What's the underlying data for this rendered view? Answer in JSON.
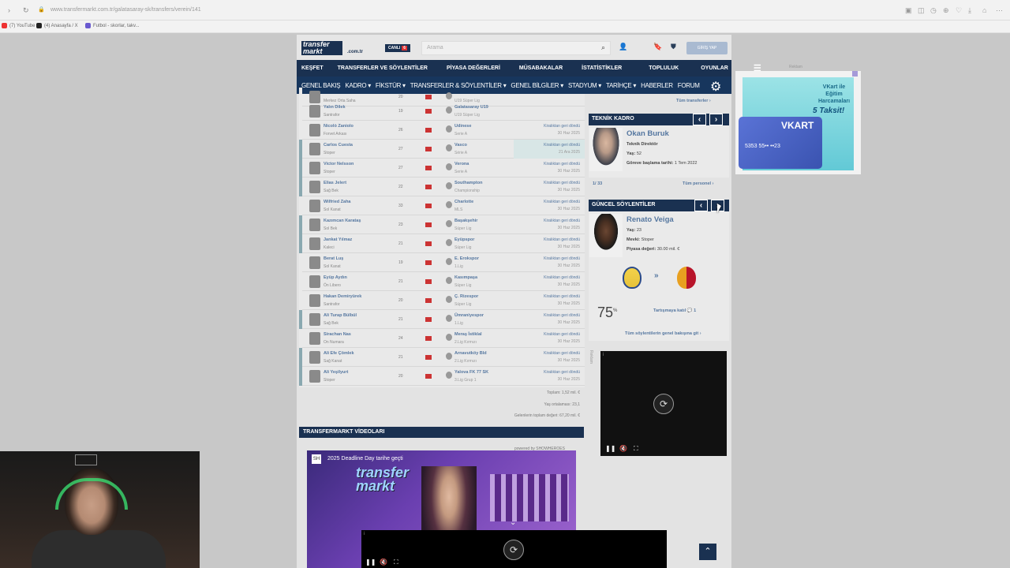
{
  "browser": {
    "url": "www.transfermarkt.com.tr/galatasaray-sk/transfers/verein/141",
    "bookmarks": [
      "(7) YouTube",
      "(4) Anasayfa / X",
      "Futbol - skorlar, takv..."
    ]
  },
  "header": {
    "logo_line1": "transfer",
    "logo_line2": "markt",
    "domain": ".com.tr",
    "live_label": "CANLI",
    "live_count": "6",
    "search_placeholder": "Arama",
    "login_label": "GİRİŞ YAP"
  },
  "main_nav": [
    "KEŞFET",
    "TRANSFERLER VE SÖYLENTİLER",
    "PİYASA DEĞERLERİ",
    "MÜSABAKALAR",
    "İSTATİSTİKLER",
    "TOPLULUK",
    "OYUNLAR"
  ],
  "sub_nav": [
    "GENEL BAKIŞ",
    "KADRO ▾",
    "FİKSTÜR ▾",
    "TRANSFERLER & SÖYLENTİLER ▾",
    "GENEL BİLGİLER ▾",
    "STADYUM ▾",
    "TARİHÇE ▾",
    "HABERLER",
    "FORUM"
  ],
  "table_rows": [
    {
      "name": "",
      "position": "Merkez Orta Saha",
      "age": "20",
      "club": "",
      "league": "U19 Süper Lig",
      "status": "",
      "date": "",
      "bar": "#e9e9e9"
    },
    {
      "name": "Yalın Dilek",
      "position": "Santrafor",
      "age": "19",
      "club": "Galatasaray U19",
      "league": "U19 Süper Lig",
      "status": "",
      "date": "",
      "bar": "#e9e9e9"
    },
    {
      "name": "Nicolò Zaniolo",
      "position": "Forvet Arkası",
      "age": "26",
      "club": "Udinese",
      "league": "Serie A",
      "status": "Kiralıktan geri döndü",
      "date": "30 Haz 2025",
      "bar": "#e9e9e9"
    },
    {
      "name": "Carlos Cuesta",
      "position": "Stoper",
      "age": "27",
      "club": "Vasco",
      "league": "Série A",
      "status": "Kiralıktan geri döndü",
      "date": "21 Ara 2025",
      "bar": "#8aa8b0"
    },
    {
      "name": "Victor Nelsson",
      "position": "Stoper",
      "age": "27",
      "club": "Verona",
      "league": "Serie A",
      "status": "Kiralıktan geri döndü",
      "date": "30 Haz 2025",
      "bar": "#8aa8b0"
    },
    {
      "name": "Elias Jelert",
      "position": "Sağ Bek",
      "age": "22",
      "club": "Southampton",
      "league": "Championship",
      "status": "Kiralıktan geri döndü",
      "date": "30 Haz 2025",
      "bar": "#8aa8b0"
    },
    {
      "name": "Wilfried Zaha",
      "position": "Sol Kanat",
      "age": "33",
      "club": "Charlotte",
      "league": "MLS",
      "status": "Kiralıktan geri döndü",
      "date": "30 Haz 2025",
      "bar": "#e9e9e9"
    },
    {
      "name": "Kazımcan Karataş",
      "position": "Sol Bek",
      "age": "23",
      "club": "Başakşehir",
      "league": "Süper Lig",
      "status": "Kiralıktan geri döndü",
      "date": "30 Haz 2025",
      "bar": "#8aa8b0"
    },
    {
      "name": "Jankat Yılmaz",
      "position": "Kaleci",
      "age": "21",
      "club": "Eyüpspor",
      "league": "Süper Lig",
      "status": "Kiralıktan geri döndü",
      "date": "30 Haz 2025",
      "bar": "#8aa8b0"
    },
    {
      "name": "Berat Luş",
      "position": "Sol Kanat",
      "age": "19",
      "club": "E. Erokspor",
      "league": "1.Lig",
      "status": "Kiralıktan geri döndü",
      "date": "30 Haz 2025",
      "bar": "#e9e9e9"
    },
    {
      "name": "Eyüp Aydın",
      "position": "Ön Libero",
      "age": "21",
      "club": "Kasımpaşa",
      "league": "Süper Lig",
      "status": "Kiralıktan geri döndü",
      "date": "30 Haz 2025",
      "bar": "#e9e9e9"
    },
    {
      "name": "Hakan Demiryürek",
      "position": "Santrafor",
      "age": "20",
      "club": "Ç. Rizespor",
      "league": "Süper Lig",
      "status": "Kiralıktan geri döndü",
      "date": "30 Haz 2025",
      "bar": "#e9e9e9"
    },
    {
      "name": "Ali Turap Bülbül",
      "position": "Sağ Bek",
      "age": "21",
      "club": "Ümraniyespor",
      "league": "1.Lig",
      "status": "Kiralıktan geri döndü",
      "date": "30 Haz 2025",
      "bar": "#8aa8b0"
    },
    {
      "name": "Sirachan Nas",
      "position": "On Numara",
      "age": "24",
      "club": "Meraş İstiklal",
      "league": "2.Lig Kırmızı",
      "status": "Kiralıktan geri döndü",
      "date": "30 Haz 2025",
      "bar": "#e9e9e9"
    },
    {
      "name": "Ali Efe Çömlek",
      "position": "Sağ Kanat",
      "age": "21",
      "club": "Arnavutköy Bld",
      "league": "2.Lig Kırmızı",
      "status": "Kiralıktan geri döndü",
      "date": "30 Haz 2025",
      "bar": "#8aa8b0"
    },
    {
      "name": "Ali Yeşilyurt",
      "position": "Stoper",
      "age": "20",
      "club": "Yalova FK 77 SK",
      "league": "3.Lig Grup 1",
      "status": "Kiralıktan geri döndü",
      "date": "30 Haz 2025",
      "bar": "#8aa8b0"
    }
  ],
  "totals": {
    "total": "Toplam: 1,52 mil. €",
    "avg_age": "Yaş ortalaması: 23,1",
    "market_value": "Gelenlerin toplam değeri: 67,20 mil. €"
  },
  "videos": {
    "header": "TRANSFERMARKT VİDEOLARI",
    "powered": "powered by SHOWHEROES",
    "title": "2025 Deadline Day tarihe geçti",
    "sh": "SH",
    "logo_line1": "transfer",
    "logo_line2": "markt"
  },
  "sidebar": {
    "all_transfers": "Tüm transferler ›",
    "staff_header": "TEKNİK KADRO",
    "coach_name": "Okan Buruk",
    "coach_role": "Teknik Direktör",
    "coach_age_label": "Yaş:",
    "coach_age": "52",
    "coach_since_label": "Göreve başlama tarihi:",
    "coach_since": "1 Tem 2022",
    "pager": "1/ 33",
    "all_staff": "Tüm personel ›",
    "rumours_header": "GÜNCEL SÖYLENTİLER",
    "rumour_name": "Renato Veiga",
    "rumour_age_label": "Yaş:",
    "rumour_age": "23",
    "rumour_pos_label": "Mevki:",
    "rumour_pos": "Stoper",
    "rumour_value_label": "Piyasa değeri:",
    "rumour_value": "30.00 mil. €",
    "percent": "75",
    "percent_sign": "%",
    "discuss": "Tartışmaya katıl 💬 1",
    "all_rumours": "Tüm söylentilerin genel bakışına git ›",
    "ad_label": "Reklam"
  },
  "right_ad": {
    "label": "Reklam",
    "title": "VKart ile Eğitim Harcamaları",
    "highlight": "5 Taksit!",
    "card_brand": "VKART",
    "card_number": "5353 55•• ••23"
  },
  "colors": {
    "brand_navy": "#1a3151",
    "link": "#5577a0",
    "webcam_headphones": "#3adb70"
  },
  "icons": [
    "search-icon",
    "user-icon",
    "bookmark-icon",
    "shield-icon",
    "gear-icon",
    "replay-icon",
    "arrow-up-icon",
    "chevron-left-icon",
    "chevron-right-icon"
  ]
}
